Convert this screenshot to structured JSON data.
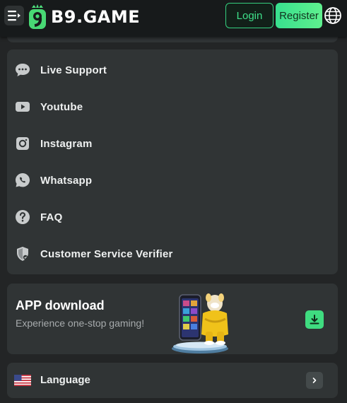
{
  "header": {
    "logo_text": "B9.GAME",
    "login_label": "Login",
    "register_label": "Register",
    "menu_icon": "menu-icon",
    "globe_icon": "globe-icon"
  },
  "menu": {
    "items": [
      {
        "label": "Live Support",
        "icon": "chat-bubble-icon"
      },
      {
        "label": "Youtube",
        "icon": "youtube-icon"
      },
      {
        "label": "Instagram",
        "icon": "instagram-icon"
      },
      {
        "label": "Whatsapp",
        "icon": "whatsapp-icon"
      },
      {
        "label": "FAQ",
        "icon": "question-icon"
      },
      {
        "label": "Customer Service Verifier",
        "icon": "shield-icon"
      }
    ]
  },
  "app_download": {
    "title": "APP download",
    "subtitle": "Experience one-stop gaming!",
    "download_icon": "download-icon"
  },
  "language": {
    "label": "Language",
    "flag_icon": "us-flag-icon",
    "chevron_icon": "chevron-right-icon"
  },
  "colors": {
    "accent": "#3fdc80",
    "background": "#232526",
    "card": "#303435",
    "header": "#171a1b"
  }
}
